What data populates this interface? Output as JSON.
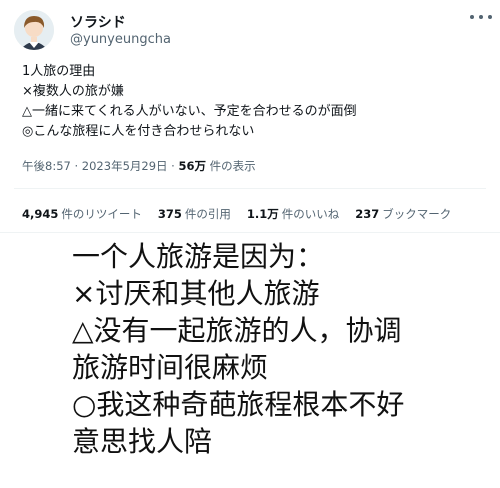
{
  "tweet": {
    "display_name": "ソラシド",
    "handle": "@yunyeungcha",
    "avatar_icon": "user-avatar-icon",
    "more_icon": "more-options-icon",
    "lines": [
      "1人旅の理由",
      "×複数人の旅が嫌",
      "△一緒に来てくれる人がいない、予定を合わせるのが面倒",
      "◎こんな旅程に人を付き合わせられない"
    ],
    "meta": {
      "time": "午後8:57",
      "separator": "·",
      "date": "2023年5月29日",
      "views_count": "56万",
      "views_label": "件の表示"
    },
    "stats": [
      {
        "count": "4,945",
        "label": "件のリツイート"
      },
      {
        "count": "375",
        "label": "件の引用"
      },
      {
        "count": "1.1万",
        "label": "件のいいね"
      },
      {
        "count": "237",
        "label": "ブックマーク"
      }
    ]
  },
  "translation": {
    "lines": [
      "一个人旅游是因为：",
      "×讨厌和其他人旅游",
      "△没有一起旅游的人，协调",
      "旅游时间很麻烦",
      "○我这种奇葩旅程根本不好",
      "意思找人陪"
    ]
  },
  "colors": {
    "text": "#0f1419",
    "secondary_text": "#536471",
    "divider": "#eff3f4",
    "background": "#ffffff"
  }
}
